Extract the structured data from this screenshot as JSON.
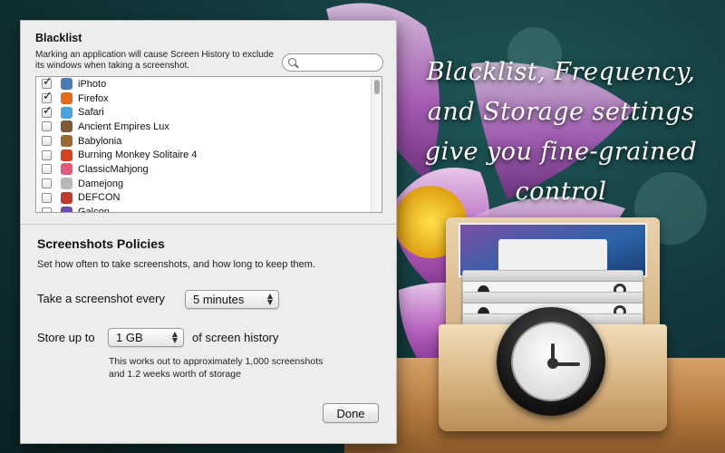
{
  "tagline": [
    "Blacklist, Frequency,",
    "and Storage settings",
    "give you fine-grained",
    "control"
  ],
  "blacklist": {
    "title": "Blacklist",
    "description": "Marking an application will cause Screen History to exclude its windows when taking a screenshot.",
    "search_placeholder": "",
    "apps": [
      {
        "name": "iPhoto",
        "checked": true,
        "icon": "iphoto-icon",
        "color": "#4a7bb5"
      },
      {
        "name": "Firefox",
        "checked": true,
        "icon": "firefox-icon",
        "color": "#e66a1c"
      },
      {
        "name": "Safari",
        "checked": true,
        "icon": "safari-icon",
        "color": "#4aa3df"
      },
      {
        "name": "Ancient Empires Lux",
        "checked": false,
        "icon": "ancient-empires-icon",
        "color": "#7b5a3a"
      },
      {
        "name": "Babylonia",
        "checked": false,
        "icon": "babylonia-icon",
        "color": "#9a6b2e"
      },
      {
        "name": "Burning Monkey Solitaire 4",
        "checked": false,
        "icon": "burning-monkey-icon",
        "color": "#d6431d"
      },
      {
        "name": "ClassicMahjong",
        "checked": false,
        "icon": "mahjong-icon",
        "color": "#e35a7a"
      },
      {
        "name": "Damejong",
        "checked": false,
        "icon": "damejong-icon",
        "color": "#b7b7b7"
      },
      {
        "name": "DEFCON",
        "checked": false,
        "icon": "defcon-icon",
        "color": "#c0392b"
      },
      {
        "name": "Galcon",
        "checked": false,
        "icon": "galcon-icon",
        "color": "#6c4bb0"
      }
    ]
  },
  "policies": {
    "title": "Screenshots Policies",
    "description": "Set how often to take screenshots, and how long to keep them.",
    "frequency_label": "Take a screenshot every",
    "frequency_value": "5 minutes",
    "store_label": "Store up to",
    "store_value": "1 GB",
    "store_suffix": "of screen history",
    "note_line1": "This works out to approximately 1,000 screenshots",
    "note_line2": "and 1.2 weeks worth of storage"
  },
  "done_label": "Done"
}
